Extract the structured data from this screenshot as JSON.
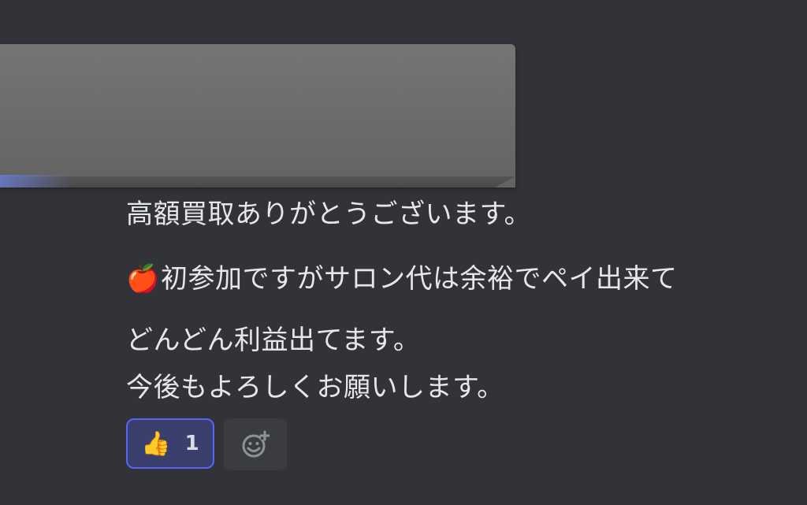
{
  "message": {
    "lines": [
      "高額買取ありがとうございます。",
      "初参加ですがサロン代は余裕でペイ出来て",
      "どんどん利益出てます。",
      "今後もよろしくお願いします。"
    ],
    "leading_emoji": "🍎"
  },
  "reactions": [
    {
      "emoji": "👍",
      "count": "1"
    }
  ],
  "icons": {
    "add_reaction": "add-reaction-icon"
  },
  "colors": {
    "background": "#313338",
    "reaction_border": "#5865f2",
    "reaction_bg": "#3a3f6e"
  }
}
